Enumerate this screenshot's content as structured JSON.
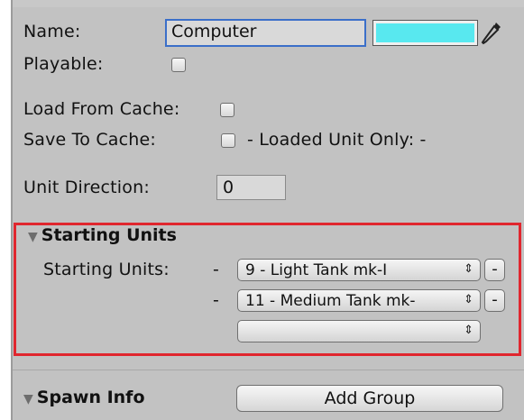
{
  "general": {
    "name_label": "Name:",
    "name_value": "Computer",
    "color_value": "#58e8ef",
    "playable_label": "Playable:",
    "load_from_cache_label": "Load From Cache:",
    "save_to_cache_label": "Save To Cache:",
    "loaded_unit_only_label": "- Loaded Unit Only: -",
    "unit_direction_label": "Unit Direction:",
    "unit_direction_value": "0"
  },
  "starting_units": {
    "header": "Starting Units",
    "field_label": "Starting Units:",
    "items": [
      {
        "dash": "-",
        "value": "9 - Light Tank mk-I",
        "remove_label": "-"
      },
      {
        "dash": "-",
        "value": "11 - Medium Tank mk-",
        "remove_label": "-"
      }
    ],
    "empty_value": ""
  },
  "spawn_info": {
    "header": "Spawn Info",
    "add_group_label": "Add Group"
  },
  "icons": {
    "foldout": "triangle-down-icon",
    "dropper": "eyedropper-icon",
    "popup_arrows": "up-down-arrows-icon"
  }
}
